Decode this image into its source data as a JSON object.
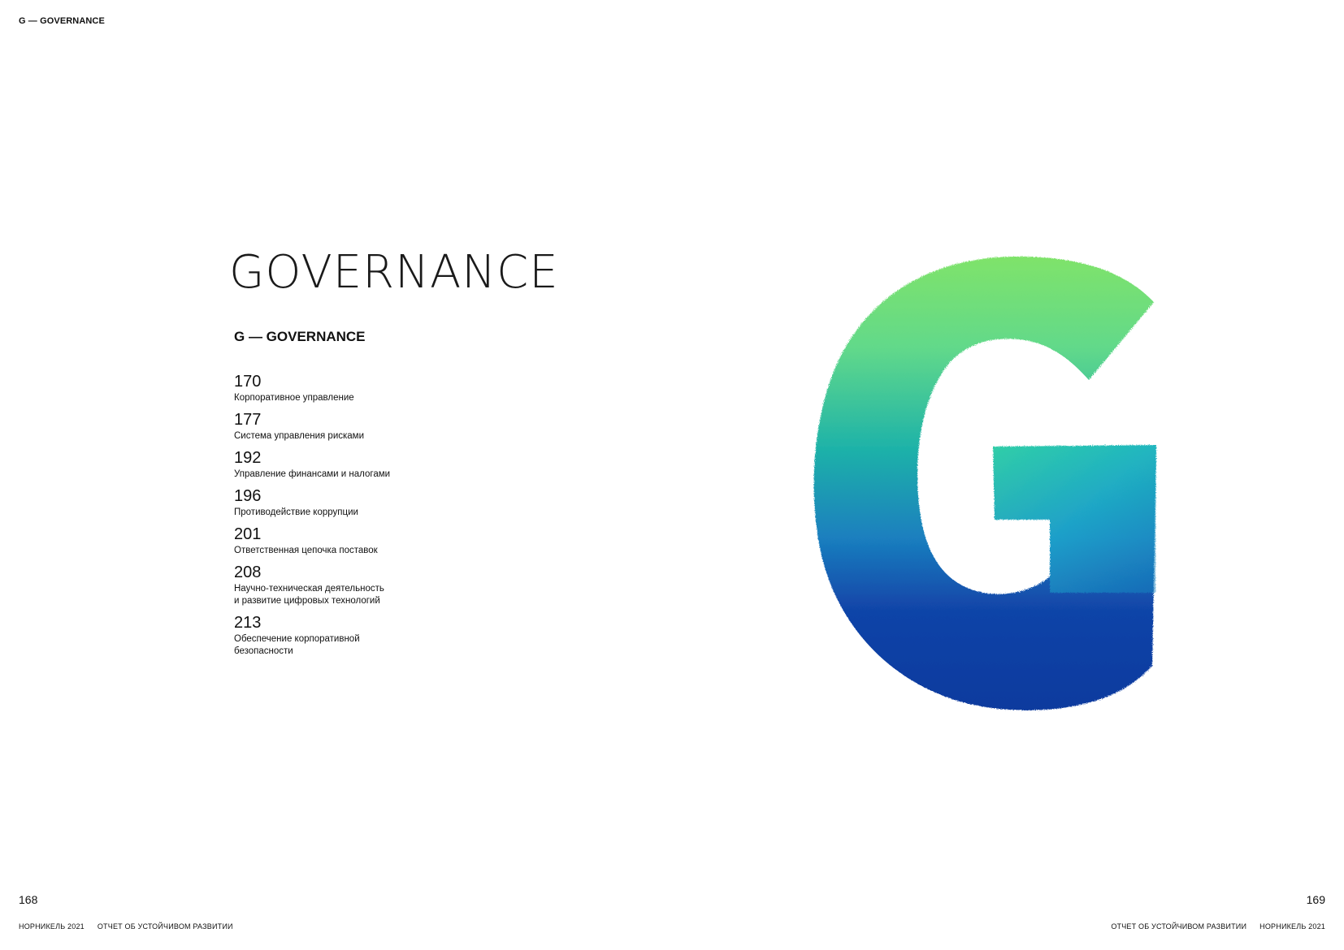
{
  "header": {
    "running_title": "G — GOVERNANCE"
  },
  "section": {
    "title": "GOVERNANCE",
    "subtitle": "G — GOVERNANCE"
  },
  "toc": [
    {
      "page": "170",
      "label": "Корпоративное управление"
    },
    {
      "page": "177",
      "label": "Система управления рисками"
    },
    {
      "page": "192",
      "label": "Управление финансами и налогами"
    },
    {
      "page": "196",
      "label": "Противодействие коррупции"
    },
    {
      "page": "201",
      "label": "Ответственная цепочка поставок"
    },
    {
      "page": "208",
      "label": "Научно-техническая деятельность\nи развитие цифровых технологий"
    },
    {
      "page": "213",
      "label": "Обеспечение корпоративной\nбезопасности"
    }
  ],
  "illustration": {
    "icon": "watercolor-letter-g-icon",
    "colors": {
      "top": "#7fe36a",
      "middle": "#1fb3a8",
      "bottom": "#0d3a9e"
    }
  },
  "footer": {
    "left_page_number": "168",
    "right_page_number": "169",
    "left": {
      "company": "НОРНИКЕЛЬ 2021",
      "report": "ОТЧЕТ ОБ УСТОЙЧИВОМ РАЗВИТИИ"
    },
    "right": {
      "report": "ОТЧЕТ ОБ УСТОЙЧИВОМ РАЗВИТИИ",
      "company": "НОРНИКЕЛЬ 2021"
    }
  }
}
